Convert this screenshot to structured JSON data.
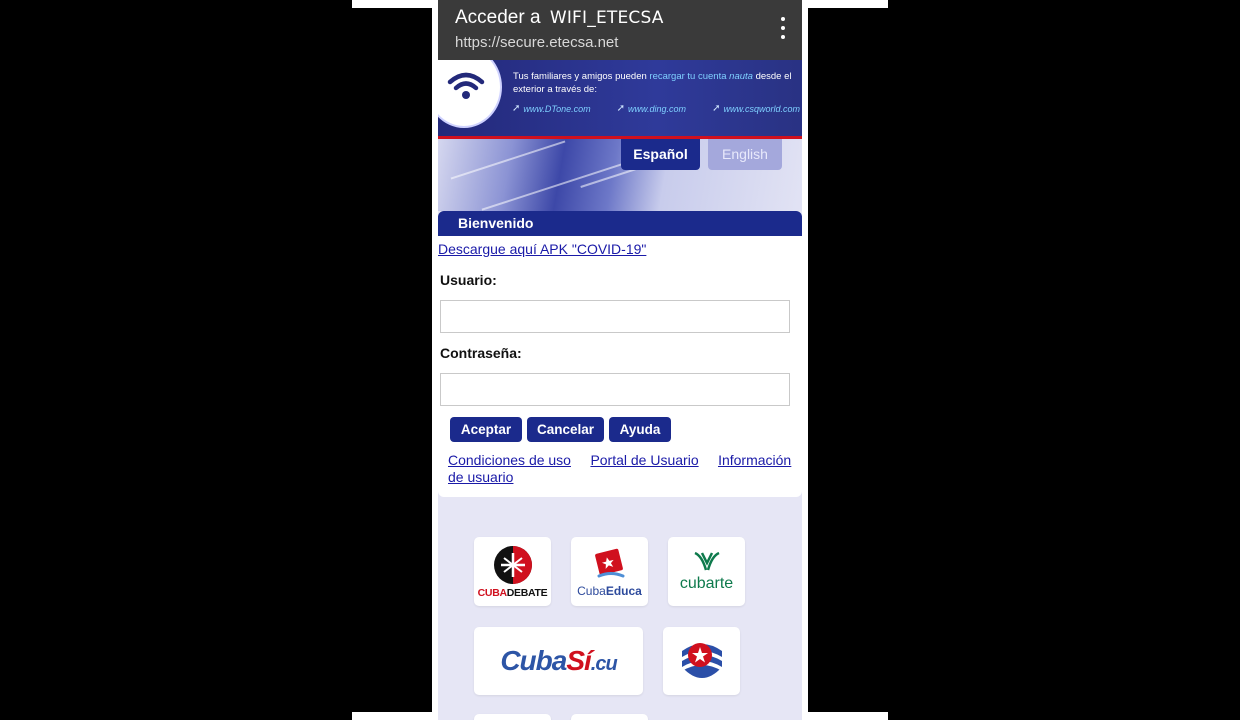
{
  "appbar": {
    "title_prefix": "Acceder a",
    "ssid": "WIFI_ETECSA",
    "url": "https://secure.etecsa.net"
  },
  "banner": {
    "line_a": "Tus familiares y amigos pueden",
    "line_b": "recargar tu cuenta",
    "line_c": "nauta",
    "line_d": "desde el exterior a través de:",
    "sites": [
      "www.DTone.com",
      "www.ding.com",
      "www.csqworld.com"
    ]
  },
  "language": {
    "es": "Español",
    "en": "English",
    "selected": "Español"
  },
  "welcome": "Bienvenido",
  "login": {
    "apk_link": "Descargue aquí APK \"COVID-19\"",
    "user_label": "Usuario:",
    "user_value": "",
    "password_label": "Contraseña:",
    "password_value": "",
    "accept": "Aceptar",
    "cancel": "Cancelar",
    "help": "Ayuda",
    "terms": "Condiciones de uso",
    "portal": "Portal de Usuario",
    "info_a": "Información",
    "info_b": "de usuario"
  },
  "tiles": {
    "cubadebate_a": "CUBA",
    "cubadebate_b": "DEBATE",
    "cubaeduca_a": "Cuba",
    "cubaeduca_b": "Educa",
    "cubarte": "cubarte",
    "cubasi_a": "Cuba",
    "cubasi_b": ".cu"
  },
  "colors": {
    "navy": "#1b2a8c",
    "link": "#1a1aa8",
    "red": "#d0101e",
    "page_bg": "#e6e6f5",
    "cubarte_green": "#0e7a4c"
  }
}
